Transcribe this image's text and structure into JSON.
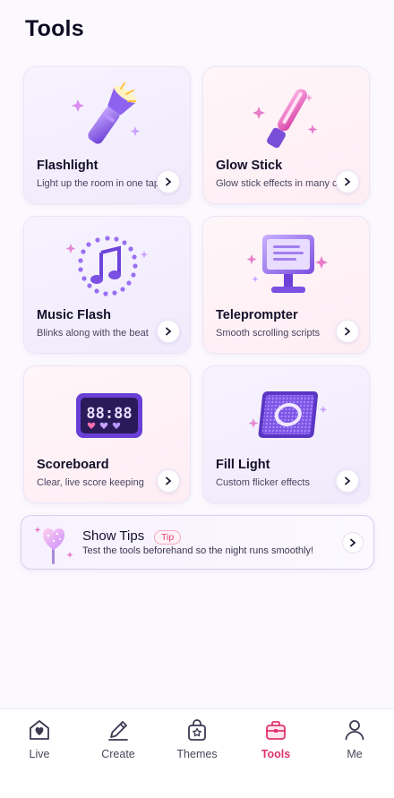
{
  "header": {
    "title": "Tools"
  },
  "tools": [
    {
      "title": "Flashlight",
      "desc": "Light up the room in one tap",
      "icon": "flashlight-icon",
      "theme": "purple"
    },
    {
      "title": "Glow Stick",
      "desc": "Glow stick effects in many colors",
      "icon": "glow-stick-icon",
      "theme": "pink"
    },
    {
      "title": "Music Flash",
      "desc": "Blinks along with the beat",
      "icon": "music-note-icon",
      "theme": "purple"
    },
    {
      "title": "Teleprompter",
      "desc": "Smooth scrolling scripts",
      "icon": "teleprompter-icon",
      "theme": "pink"
    },
    {
      "title": "Scoreboard",
      "desc": "Clear, live score keeping",
      "icon": "scoreboard-icon",
      "theme": "pink"
    },
    {
      "title": "Fill Light",
      "desc": "Custom flicker effects",
      "icon": "fill-light-icon",
      "theme": "purple"
    }
  ],
  "tips": {
    "title": "Show Tips",
    "badge": "Tip",
    "text": "Test the tools beforehand so the night runs smoothly!",
    "icon": "heart-lollipop-icon"
  },
  "tabbar": {
    "active": "Tools",
    "items": [
      {
        "label": "Live",
        "icon": "heart-house-icon"
      },
      {
        "label": "Create",
        "icon": "pencil-icon"
      },
      {
        "label": "Themes",
        "icon": "star-bag-icon"
      },
      {
        "label": "Tools",
        "icon": "toolbox-icon"
      },
      {
        "label": "Me",
        "icon": "person-icon"
      }
    ]
  },
  "colors": {
    "accent_pink": "#e0336f",
    "purple": "#8a5cf0",
    "text": "#14102a"
  }
}
